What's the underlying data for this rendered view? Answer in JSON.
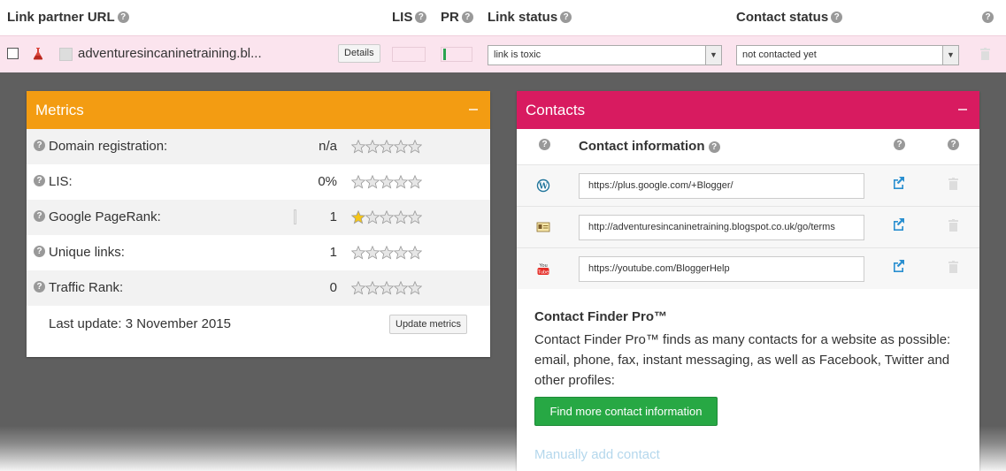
{
  "table_header": {
    "link_partner_url": "Link partner URL",
    "lis": "LIS",
    "pr": "PR",
    "link_status": "Link status",
    "contact_status": "Contact status"
  },
  "row": {
    "url": "adventuresincaninetraining.bl...",
    "details_label": "Details",
    "pr_fill_fraction": 0.08,
    "link_status": "link is toxic",
    "contact_status": "not contacted yet"
  },
  "metrics": {
    "title": "Metrics",
    "rows": [
      {
        "label": "Domain registration:",
        "value": "n/a",
        "stars": 0
      },
      {
        "label": "LIS:",
        "value": "0%",
        "stars": 0
      },
      {
        "label": "Google PageRank:",
        "value": "1",
        "stars": 1
      },
      {
        "label": "Unique links:",
        "value": "1",
        "stars": 0
      },
      {
        "label": "Traffic Rank:",
        "value": "0",
        "stars": 0
      }
    ],
    "last_update": "Last update: 3 November 2015",
    "update_button": "Update metrics"
  },
  "contacts": {
    "title": "Contacts",
    "header": "Contact information",
    "rows": [
      {
        "icon": "wordpress-icon",
        "value": "https://plus.google.com/+Blogger/"
      },
      {
        "icon": "contact-card-icon",
        "value": "http://adventuresincaninetraining.blogspot.co.uk/go/terms"
      },
      {
        "icon": "youtube-icon",
        "value": "https://youtube.com/BloggerHelp"
      }
    ],
    "finder_title": "Contact Finder Pro™",
    "finder_desc": "Contact Finder Pro™ finds as many contacts for a website as possible: email, phone, fax, instant messaging, as well as Facebook, Twitter and other profiles:",
    "find_button": "Find more contact information",
    "manual_add": "Manually add contact"
  },
  "colors": {
    "metrics_header": "#f39c12",
    "contacts_header": "#d81b60",
    "row_highlight": "#fbe4ee",
    "find_button": "#27a844"
  }
}
